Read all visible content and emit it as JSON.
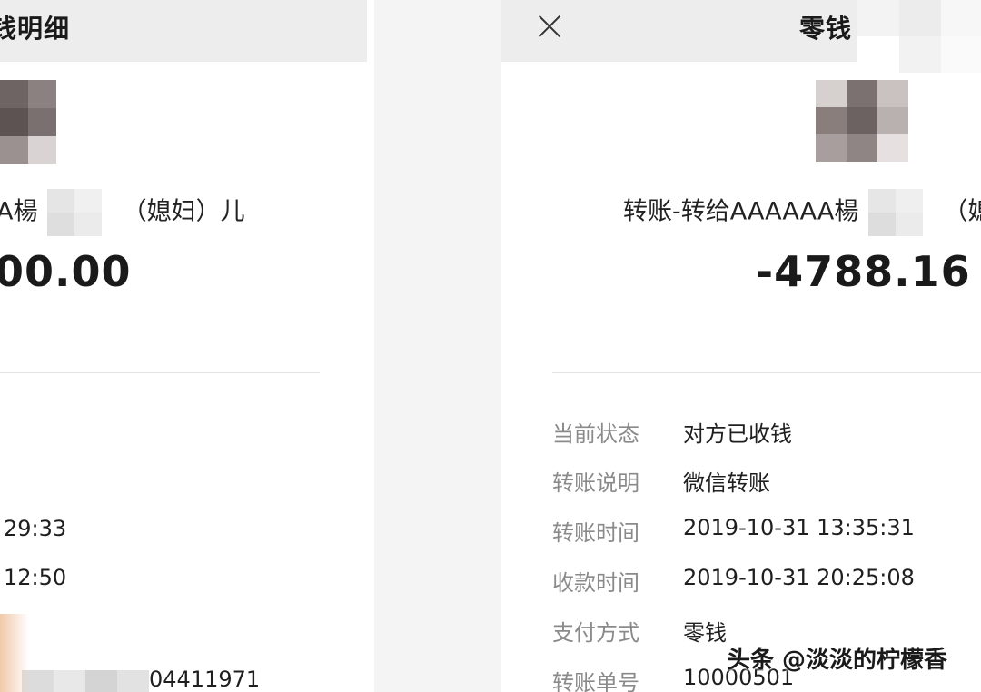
{
  "left": {
    "header_title": "钱明细",
    "party_prefix": "A楊",
    "party_suffix": "（媳妇）儿",
    "amount": "00.00",
    "values": [
      "29:33",
      "12:50",
      "04411971"
    ]
  },
  "right": {
    "header_title": "零钱",
    "close_icon": "close-icon",
    "party_prefix": "转账-转给AAAAAA楊",
    "party_suffix": "（媳",
    "amount": "-4788.16",
    "details": [
      {
        "label": "当前状态",
        "value": "对方已收钱"
      },
      {
        "label": "转账说明",
        "value": "微信转账"
      },
      {
        "label": "转账时间",
        "value": "2019-10-31 13:35:31"
      },
      {
        "label": "收款时间",
        "value": "2019-10-31 20:25:08"
      },
      {
        "label": "支付方式",
        "value": "零钱"
      },
      {
        "label": "转账单号",
        "value": "10000501"
      }
    ]
  },
  "watermark": "头条 @淡淡的柠檬香"
}
